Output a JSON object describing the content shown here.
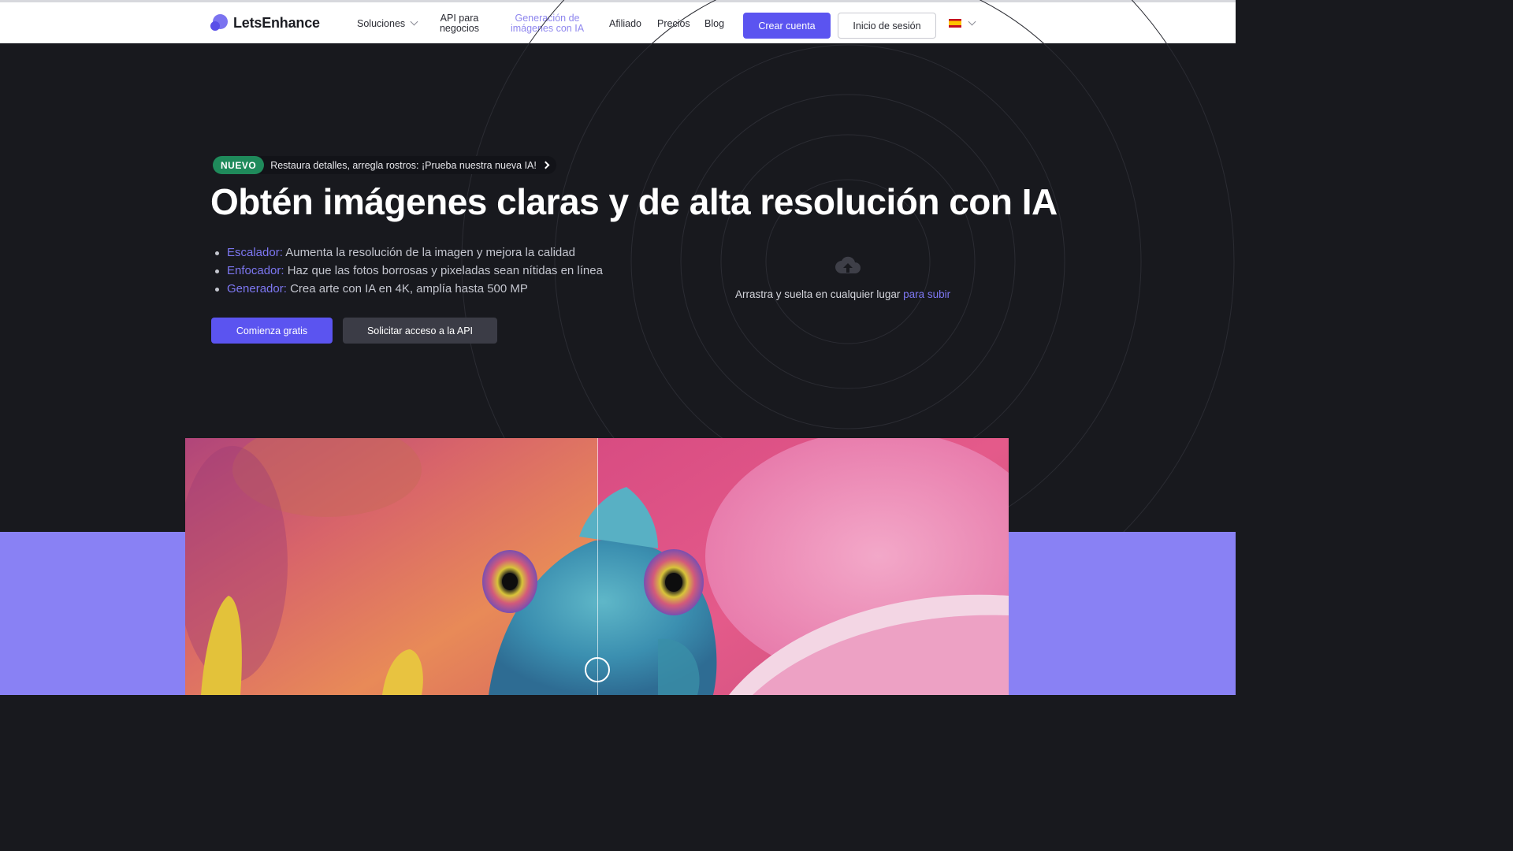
{
  "nav": {
    "logo_text": "LetsEnhance",
    "solutions": "Soluciones",
    "api_line1": "API para",
    "api_line2": "negocios",
    "gen_line1": "Generación de",
    "gen_line2": "imágenes con IA",
    "affiliate": "Afiliado",
    "pricing": "Precios",
    "blog": "Blog",
    "create_account": "Crear cuenta",
    "login": "Inicio de sesión",
    "language_flag": "spain-flag-icon"
  },
  "hero": {
    "badge": "NUEVO",
    "badge_text": "Restaura detalles, arregla rostros: ¡Prueba nuestra nueva IA!",
    "title": "Obtén imágenes claras y de alta resolución con IA",
    "features": [
      {
        "keyword": "Escalador:",
        "text": "Aumenta la resolución de la imagen y mejora la calidad"
      },
      {
        "keyword": "Enfocador:",
        "text": "Haz que las fotos borrosas y pixeladas sean nítidas en línea"
      },
      {
        "keyword": "Generador:",
        "text": "Crea arte con IA en 4K, amplía hasta 500 MP"
      }
    ],
    "cta_start": "Comienza gratis",
    "cta_api": "Solicitar acceso a la API"
  },
  "upload": {
    "text": "Arrastra y suelta en cualquier lugar",
    "link": "para subir",
    "icon": "cloud-upload-icon"
  },
  "colors": {
    "accent": "#5b54f0",
    "link": "#7d77f2",
    "hero_bg": "#18191e",
    "band": "#8981f4",
    "badge_green": "#1f8a5b"
  }
}
